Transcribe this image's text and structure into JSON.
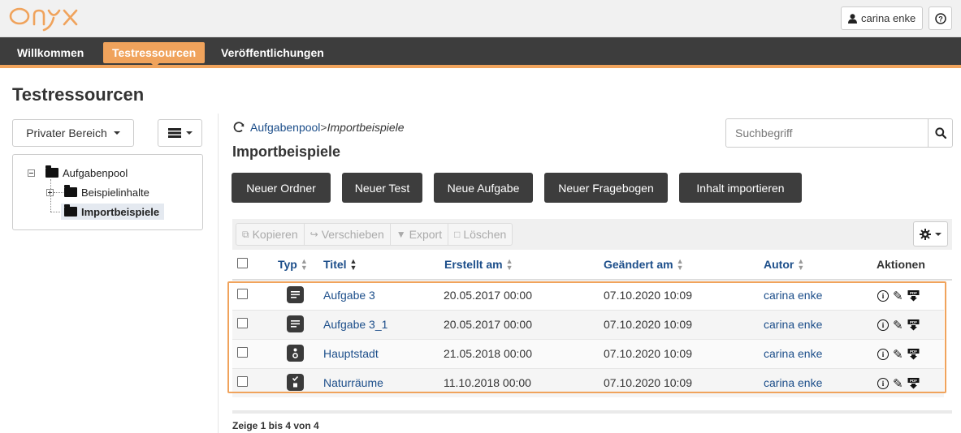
{
  "app": {
    "logo_text": "Onyx"
  },
  "header": {
    "user_name": "carina enke",
    "help_icon": "help-icon"
  },
  "nav": {
    "items": [
      {
        "label": "Willkommen",
        "active": false
      },
      {
        "label": "Testressourcen",
        "active": true
      },
      {
        "label": "Veröffentlichungen",
        "active": false
      }
    ]
  },
  "page": {
    "title": "Testressourcen"
  },
  "sidebar": {
    "scope_label": "Privater Bereich",
    "view_icon": "list-view-icon",
    "tree": [
      {
        "label": "Aufgabenpool",
        "level": 0,
        "expanded": true,
        "selected": false
      },
      {
        "label": "Beispielinhalte",
        "level": 1,
        "expanded": false,
        "selected": false
      },
      {
        "label": "Importbeispiele",
        "level": 1,
        "expanded": false,
        "selected": true
      }
    ]
  },
  "breadcrumb": {
    "root": "Aufgabenpool",
    "separator": ">",
    "current": "Importbeispiele"
  },
  "folder": {
    "title": "Importbeispiele"
  },
  "search": {
    "placeholder": "Suchbegriff",
    "value": ""
  },
  "actions": {
    "new_folder": "Neuer Ordner",
    "new_test": "Neuer Test",
    "new_task": "Neue Aufgabe",
    "new_questionnaire": "Neuer Fragebogen",
    "import_content": "Inhalt importieren"
  },
  "toolbar": {
    "copy": "Kopieren",
    "move": "Verschieben",
    "export": "Export",
    "delete": "Löschen"
  },
  "table": {
    "columns": {
      "type": "Typ",
      "title": "Titel",
      "created": "Erstellt am",
      "changed": "Geändert am",
      "author": "Autor",
      "actions": "Aktionen"
    },
    "rows": [
      {
        "type_icon": "text-task-icon",
        "title": "Aufgabe 3",
        "created": "20.05.2017 00:00",
        "changed": "07.10.2020 10:09",
        "author": "carina enke"
      },
      {
        "type_icon": "text-task-icon",
        "title": "Aufgabe 3_1",
        "created": "20.05.2017 00:00",
        "changed": "07.10.2020 10:09",
        "author": "carina enke"
      },
      {
        "type_icon": "single-choice-icon",
        "title": "Hauptstadt",
        "created": "21.05.2018 00:00",
        "changed": "07.10.2020 10:09",
        "author": "carina enke"
      },
      {
        "type_icon": "checklist-icon",
        "title": "Naturräume",
        "created": "11.10.2018 00:00",
        "changed": "07.10.2020 10:09",
        "author": "carina enke"
      }
    ]
  },
  "pager": {
    "text": "Zeige 1 bis 4 von 4"
  },
  "colors": {
    "accent": "#f0a35c",
    "nav_bg": "#3d3d3d",
    "link": "#1c4e8a"
  }
}
